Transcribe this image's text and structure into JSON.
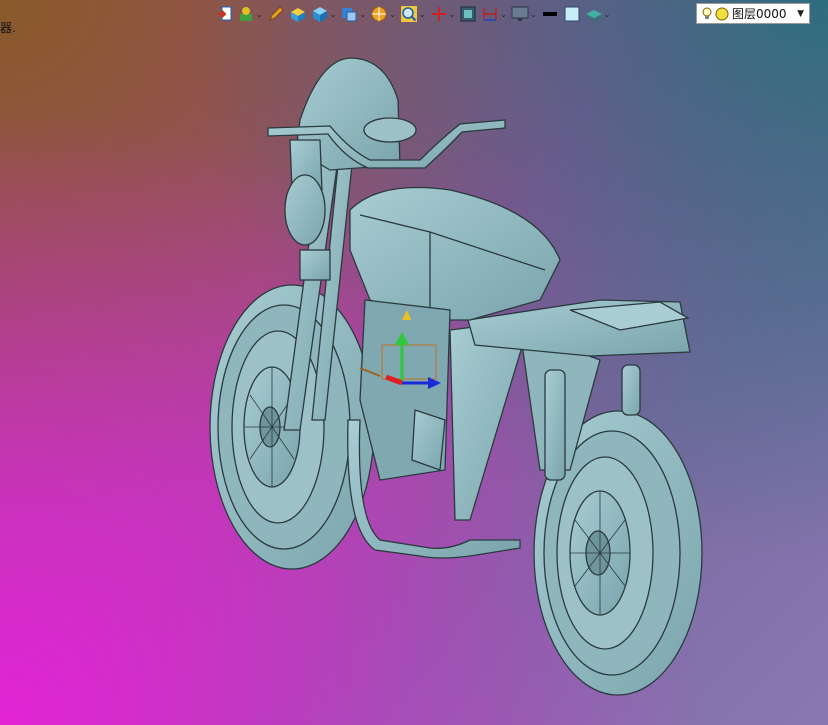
{
  "left_text": "器.",
  "toolbar": {
    "buttons": [
      {
        "name": "import-icon",
        "dropdown": false
      },
      {
        "name": "snap-icon",
        "dropdown": true
      },
      {
        "name": "pencil-icon",
        "dropdown": false
      },
      {
        "name": "box-color-icon",
        "dropdown": false
      },
      {
        "name": "cube-icon",
        "dropdown": true
      },
      {
        "name": "cube-view-icon",
        "dropdown": true
      },
      {
        "name": "render-mode-icon",
        "dropdown": true
      },
      {
        "name": "zoom-icon",
        "dropdown": true
      },
      {
        "name": "axis-icon",
        "dropdown": true
      },
      {
        "name": "frame-icon",
        "dropdown": false
      },
      {
        "name": "dimension-icon",
        "dropdown": true
      },
      {
        "name": "monitor-icon",
        "dropdown": true
      },
      {
        "name": "line-color-icon",
        "dropdown": false
      },
      {
        "name": "fill-color-icon",
        "dropdown": false
      },
      {
        "name": "layers-icon",
        "dropdown": true
      }
    ]
  },
  "layer": {
    "name": "图层0000"
  },
  "colors": {
    "model_fill": "#8fb6bd",
    "model_edge": "#2a3a3e",
    "axis_x": "#1a2ad8",
    "axis_y": "#2ec83a",
    "axis_z": "#e02020"
  }
}
